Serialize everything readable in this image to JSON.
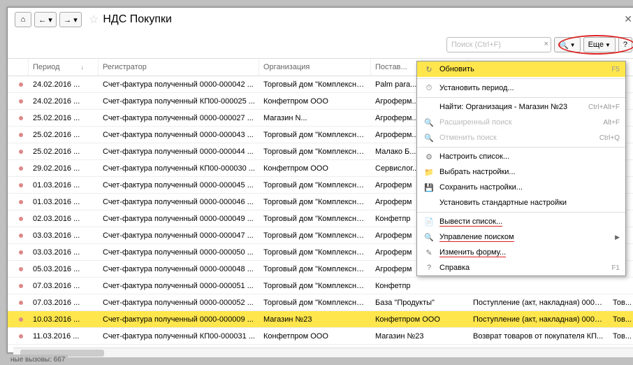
{
  "header": {
    "title": "НДС Покупки"
  },
  "toolbar": {
    "search_placeholder": "Поиск (Ctrl+F)",
    "more_label": "Еще"
  },
  "columns": {
    "period": "Период",
    "registrar": "Регистратор",
    "organization": "Организация",
    "supplier": "Постав..."
  },
  "rows": [
    {
      "period": "24.02.2016 ...",
      "registrar": "Счет-фактура полученный 0000-000042 ...",
      "org": "Торговый дом \"Комплексный...",
      "supplier": "Palm para...",
      "doc": "",
      "extra": "",
      "sel": false
    },
    {
      "period": "24.02.2016 ...",
      "registrar": "Счет-фактура полученный КП00-000025 ...",
      "org": "Конфетпром ООО",
      "supplier": "Агроферм...",
      "doc": "",
      "extra": "",
      "sel": false
    },
    {
      "period": "25.02.2016 ...",
      "registrar": "Счет-фактура полученный 0000-000027 ...",
      "org": "Магазин N...",
      "supplier": "Агроферм...",
      "doc": "",
      "extra": "",
      "sel": false
    },
    {
      "period": "25.02.2016 ...",
      "registrar": "Счет-фактура полученный 0000-000043 ...",
      "org": "Торговый дом \"Комплексный...",
      "supplier": "Агроферм...",
      "doc": "",
      "extra": "",
      "sel": false
    },
    {
      "period": "25.02.2016 ...",
      "registrar": "Счет-фактура полученный 0000-000044 ...",
      "org": "Торговый дом \"Комплексный...",
      "supplier": "Малако Б...",
      "doc": "",
      "extra": "",
      "sel": false
    },
    {
      "period": "29.02.2016 ...",
      "registrar": "Счет-фактура полученный КП00-000030 ...",
      "org": "Конфетпром ООО",
      "supplier": "Сервислог...",
      "doc": "",
      "extra": "",
      "sel": false
    },
    {
      "period": "01.03.2016 ...",
      "registrar": "Счет-фактура полученный 0000-000045 ...",
      "org": "Торговый дом \"Комплексный...",
      "supplier": "Агроферм",
      "doc": "",
      "extra": "",
      "sel": false
    },
    {
      "period": "01.03.2016 ...",
      "registrar": "Счет-фактура полученный 0000-000046 ...",
      "org": "Торговый дом \"Комплексный...",
      "supplier": "Агроферм",
      "doc": "",
      "extra": "",
      "sel": false
    },
    {
      "period": "02.03.2016 ...",
      "registrar": "Счет-фактура полученный 0000-000049 ...",
      "org": "Торговый дом \"Комплексный...",
      "supplier": "Конфетпр",
      "doc": "",
      "extra": "",
      "sel": false
    },
    {
      "period": "03.03.2016 ...",
      "registrar": "Счет-фактура полученный 0000-000047 ...",
      "org": "Торговый дом \"Комплексный...",
      "supplier": "Агроферм",
      "doc": "",
      "extra": "",
      "sel": false
    },
    {
      "period": "03.03.2016 ...",
      "registrar": "Счет-фактура полученный 0000-000050 ...",
      "org": "Торговый дом \"Комплексный...",
      "supplier": "Агроферм",
      "doc": "",
      "extra": "",
      "sel": false
    },
    {
      "period": "05.03.2016 ...",
      "registrar": "Счет-фактура полученный 0000-000048 ...",
      "org": "Торговый дом \"Комплексный...",
      "supplier": "Агроферм",
      "doc": "",
      "extra": "",
      "sel": false
    },
    {
      "period": "07.03.2016 ...",
      "registrar": "Счет-фактура полученный 0000-000051 ...",
      "org": "Торговый дом \"Комплексный...",
      "supplier": "Конфетпр",
      "doc": "",
      "extra": "",
      "sel": false
    },
    {
      "period": "07.03.2016 ...",
      "registrar": "Счет-фактура полученный 0000-000052 ...",
      "org": "Торговый дом \"Комплексный...",
      "supplier": "База \"Продукты\"",
      "doc": "Поступление (акт, накладная) 0000-...",
      "extra": "Тов...",
      "sel": false
    },
    {
      "period": "10.03.2016 ...",
      "registrar": "Счет-фактура полученный 0000-000009 ...",
      "org": "Магазин №23",
      "supplier": "Конфетпром ООО",
      "doc": "Поступление (акт, накладная) 0000-...",
      "extra": "Тов...",
      "sel": true
    },
    {
      "period": "11.03.2016 ...",
      "registrar": "Счет-фактура полученный КП00-000031 ...",
      "org": "Конфетпром ООО",
      "supplier": "Магазин №23",
      "doc": "Возврат товаров от покупателя КП...",
      "extra": "Тов...",
      "sel": false
    }
  ],
  "menu": [
    {
      "icon": "↻",
      "label": "Обновить",
      "shortcut": "F5",
      "type": "item",
      "hl": true
    },
    {
      "type": "sep"
    },
    {
      "icon": "⏱",
      "label": "Установить период...",
      "shortcut": "",
      "type": "item"
    },
    {
      "type": "sep"
    },
    {
      "icon": "",
      "label": "Найти: Организация - Магазин №23",
      "shortcut": "Ctrl+Alt+F",
      "type": "item"
    },
    {
      "icon": "🔍",
      "label": "Расширенный поиск",
      "shortcut": "Alt+F",
      "type": "item",
      "dim": true
    },
    {
      "icon": "🔍",
      "label": "Отменить поиск",
      "shortcut": "Ctrl+Q",
      "type": "item",
      "dim": true
    },
    {
      "type": "sep"
    },
    {
      "icon": "⚙",
      "label": "Настроить список...",
      "shortcut": "",
      "type": "item"
    },
    {
      "icon": "📁",
      "label": "Выбрать настройки...",
      "shortcut": "",
      "type": "item"
    },
    {
      "icon": "💾",
      "label": "Сохранить настройки...",
      "shortcut": "",
      "type": "item"
    },
    {
      "icon": "",
      "label": "Установить стандартные настройки",
      "shortcut": "",
      "type": "item"
    },
    {
      "type": "sep"
    },
    {
      "icon": "📄",
      "label": "Вывести список...",
      "shortcut": "",
      "type": "item",
      "underline": true
    },
    {
      "icon": "🔍",
      "label": "Управление поиском",
      "shortcut": "",
      "type": "item",
      "submenu": true,
      "underline": true
    },
    {
      "icon": "✎",
      "label": "Изменить форму...",
      "shortcut": "",
      "type": "item",
      "underline": true
    },
    {
      "icon": "?",
      "label": "Справка",
      "shortcut": "F1",
      "type": "item"
    }
  ],
  "status": "ные вызовы: 667"
}
